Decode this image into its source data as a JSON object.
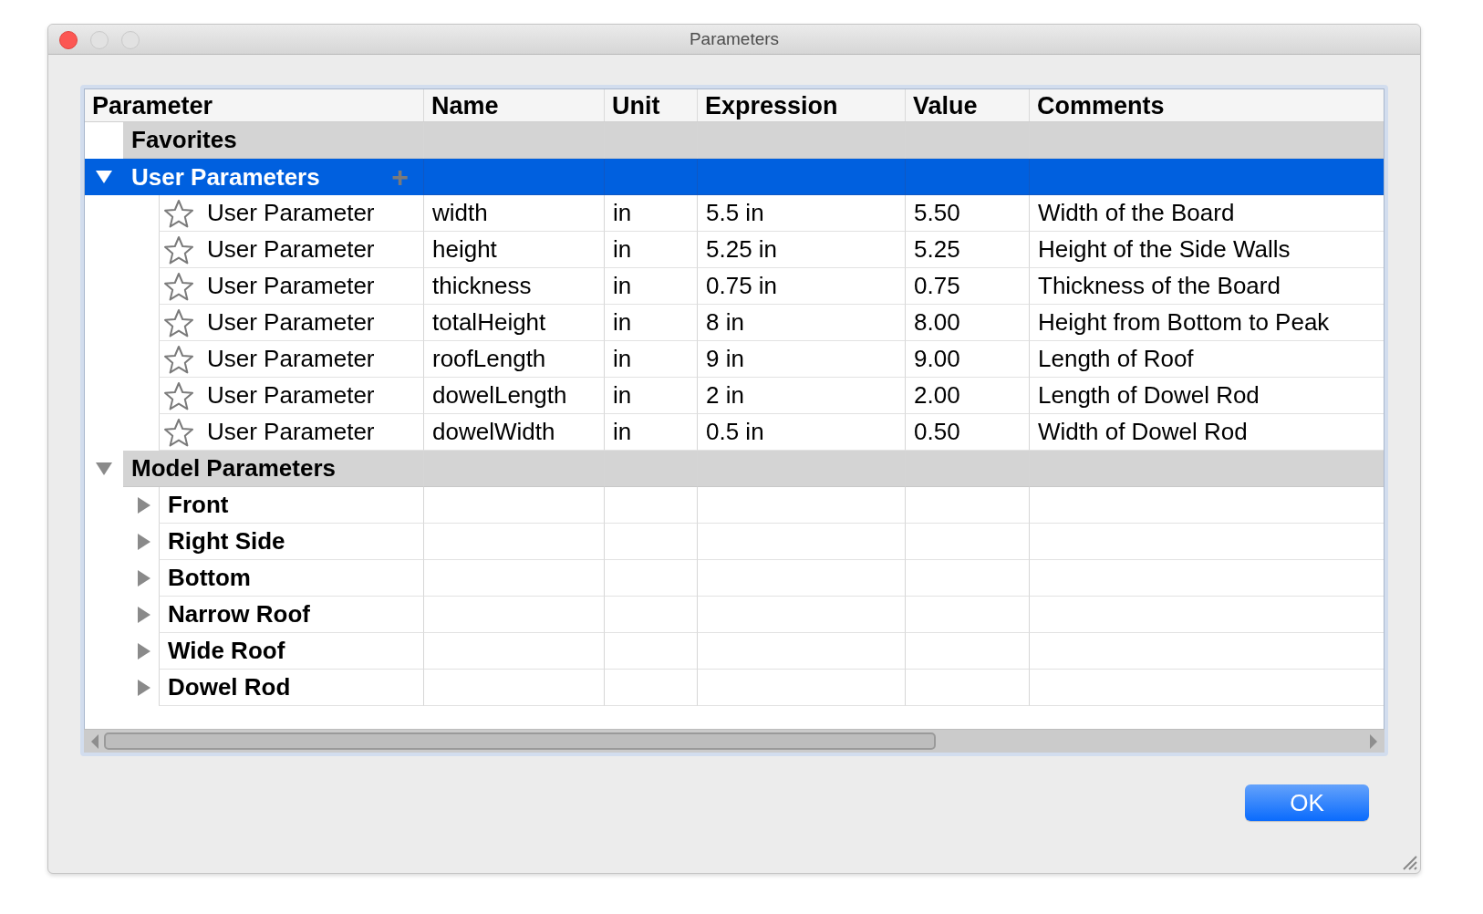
{
  "window": {
    "title": "Parameters"
  },
  "table": {
    "columns": [
      "Parameter",
      "Name",
      "Unit",
      "Expression",
      "Value",
      "Comments"
    ],
    "sections": [
      {
        "label": "Favorites",
        "selected": false
      },
      {
        "label": "User Parameters",
        "selected": true,
        "expanded": true,
        "add_button": "+",
        "children": [
          {
            "kind": "parameter",
            "favorite": false,
            "cells": [
              "User Parameter",
              "width",
              "in",
              "5.5 in",
              "5.50",
              "Width of the Board"
            ]
          },
          {
            "kind": "parameter",
            "favorite": false,
            "cells": [
              "User Parameter",
              "height",
              "in",
              "5.25 in",
              "5.25",
              "Height of the Side Walls"
            ]
          },
          {
            "kind": "parameter",
            "favorite": false,
            "cells": [
              "User Parameter",
              "thickness",
              "in",
              "0.75 in",
              "0.75",
              "Thickness of the Board"
            ]
          },
          {
            "kind": "parameter",
            "favorite": false,
            "cells": [
              "User Parameter",
              "totalHeight",
              "in",
              "8 in",
              "8.00",
              "Height from Bottom to Peak"
            ]
          },
          {
            "kind": "parameter",
            "favorite": false,
            "cells": [
              "User Parameter",
              "roofLength",
              "in",
              "9 in",
              "9.00",
              "Length of Roof"
            ]
          },
          {
            "kind": "parameter",
            "favorite": false,
            "cells": [
              "User Parameter",
              "dowelLength",
              "in",
              "2 in",
              "2.00",
              "Length of Dowel Rod"
            ]
          },
          {
            "kind": "parameter",
            "favorite": false,
            "cells": [
              "User Parameter",
              "dowelWidth",
              "in",
              "0.5 in",
              "0.50",
              "Width of Dowel Rod"
            ]
          }
        ]
      },
      {
        "label": "Model Parameters",
        "selected": false,
        "expanded": true,
        "children": [
          {
            "kind": "component",
            "label": "Front",
            "expanded": false
          },
          {
            "kind": "component",
            "label": "Right Side",
            "expanded": false
          },
          {
            "kind": "component",
            "label": "Bottom",
            "expanded": false
          },
          {
            "kind": "component",
            "label": "Narrow Roof",
            "expanded": false
          },
          {
            "kind": "component",
            "label": "Wide Roof",
            "expanded": false
          },
          {
            "kind": "component",
            "label": "Dowel Rod",
            "expanded": false
          }
        ]
      }
    ]
  },
  "buttons": [
    "OK"
  ]
}
